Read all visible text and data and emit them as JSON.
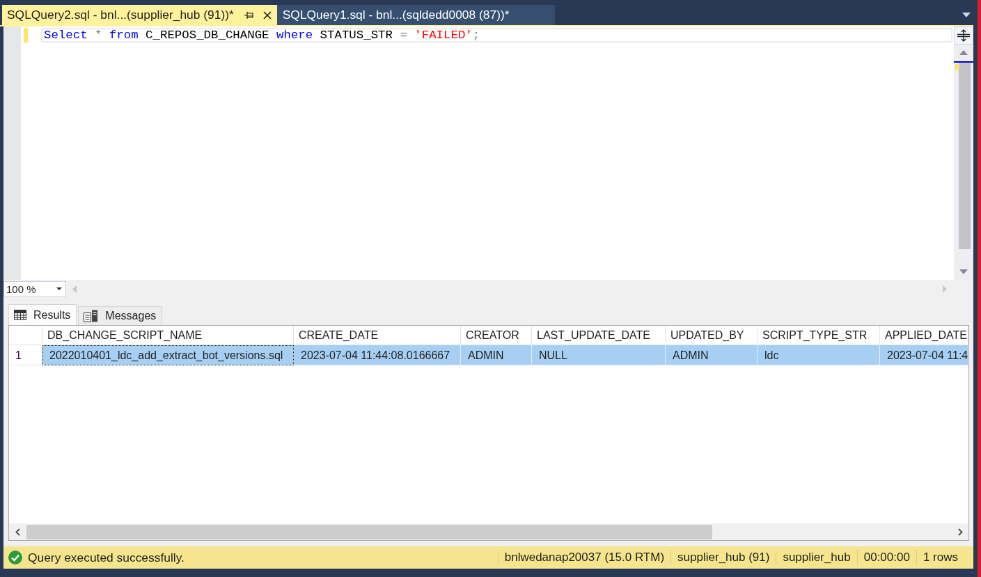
{
  "tabs": [
    {
      "label": "SQLQuery2.sql - bnl...(supplier_hub (91))*",
      "selected": true
    },
    {
      "label": "SQLQuery1.sql - bnl...(sqldedd0008 (87))*",
      "selected": false
    }
  ],
  "editor": {
    "lines": [
      {
        "modified": true,
        "current": true,
        "tokens": [
          {
            "text": "Select",
            "kind": "keyword"
          },
          {
            "text": " * ",
            "kind": "operator"
          },
          {
            "text": "from",
            "kind": "keyword"
          },
          {
            "text": " C_REPOS_DB_CHANGE ",
            "kind": "identifier"
          },
          {
            "text": "where",
            "kind": "keyword"
          },
          {
            "text": " STATUS_STR ",
            "kind": "identifier"
          },
          {
            "text": "= ",
            "kind": "operator"
          },
          {
            "text": "'FAILED'",
            "kind": "string"
          },
          {
            "text": ";",
            "kind": "operator"
          }
        ]
      }
    ]
  },
  "zoom": {
    "value": "100 %"
  },
  "result_tabs": [
    {
      "label": "Results",
      "kind": "grid",
      "selected": true
    },
    {
      "label": "Messages",
      "kind": "messages",
      "selected": false
    }
  ],
  "grid": {
    "columns": [
      "DB_CHANGE_SCRIPT_NAME",
      "CREATE_DATE",
      "CREATOR",
      "LAST_UPDATE_DATE",
      "UPDATED_BY",
      "SCRIPT_TYPE_STR",
      "APPLIED_DATE"
    ],
    "rows": [
      {
        "number": "1",
        "selected": true,
        "cells": [
          {
            "text": "2022010401_ldc_add_extract_bot_versions.sql",
            "focused": true
          },
          {
            "text": "2023-07-04 11:44:08.0166667",
            "focused": false
          },
          {
            "text": "ADMIN",
            "focused": false
          },
          {
            "text": "NULL",
            "focused": false
          },
          {
            "text": "ADMIN",
            "focused": false
          },
          {
            "text": "ldc",
            "focused": false
          },
          {
            "text": "2023-07-04 11:4",
            "focused": false
          }
        ]
      }
    ]
  },
  "status_bar": {
    "succeeded": true,
    "message": "Query executed successfully.",
    "segments": [
      "bnlwedanap20037 (15.0 RTM)",
      "supplier_hub (91)",
      "supplier_hub",
      "00:00:00",
      "1 rows"
    ]
  }
}
